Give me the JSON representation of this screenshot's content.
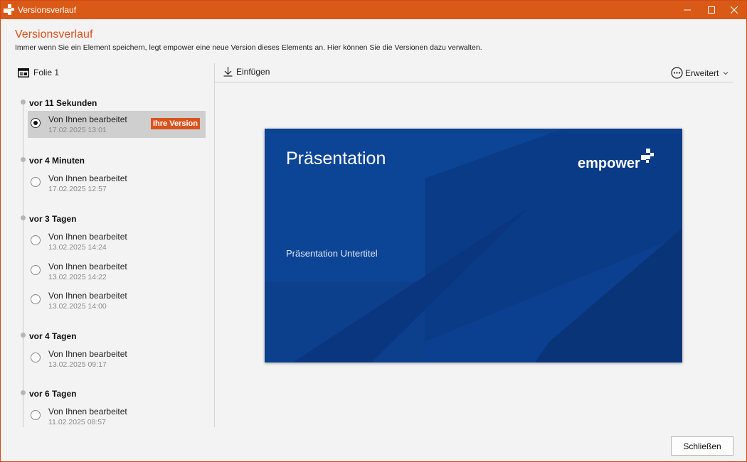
{
  "window": {
    "title": "Versionsverlauf",
    "accent_color": "#d95a16"
  },
  "header": {
    "title": "Versionsverlauf",
    "description": "Immer wenn Sie ein Element speichern, legt empower eine neue Version dieses Elements an. Hier können Sie die Versionen dazu verwalten."
  },
  "toolbar": {
    "slide_label": "Folie 1",
    "insert_label": "Einfügen",
    "advanced_label": "Erweitert"
  },
  "groups": [
    {
      "label": "vor 11 Sekunden",
      "entries": [
        {
          "title": "Von Ihnen bearbeitet",
          "date": "17.02.2025 13:01",
          "badge": "Ihre Version",
          "selected": true
        }
      ]
    },
    {
      "label": "vor 4 Minuten",
      "entries": [
        {
          "title": "Von Ihnen bearbeitet",
          "date": "17.02.2025 12:57"
        }
      ]
    },
    {
      "label": "vor 3 Tagen",
      "entries": [
        {
          "title": "Von Ihnen bearbeitet",
          "date": "13.02.2025 14:24"
        },
        {
          "title": "Von Ihnen bearbeitet",
          "date": "13.02.2025 14:22"
        },
        {
          "title": "Von Ihnen bearbeitet",
          "date": "13.02.2025 14:00"
        }
      ]
    },
    {
      "label": "vor 4 Tagen",
      "entries": [
        {
          "title": "Von Ihnen bearbeitet",
          "date": "13.02.2025 09:17"
        }
      ]
    },
    {
      "label": "vor 6 Tagen",
      "entries": [
        {
          "title": "Von Ihnen bearbeitet",
          "date": "11.02.2025 08:57"
        }
      ]
    }
  ],
  "preview": {
    "title": "Präsentation",
    "subtitle": "Präsentation Untertitel",
    "logo_text": "empower",
    "background_color": "#0b3f8f"
  },
  "footer": {
    "close_label": "Schließen"
  }
}
